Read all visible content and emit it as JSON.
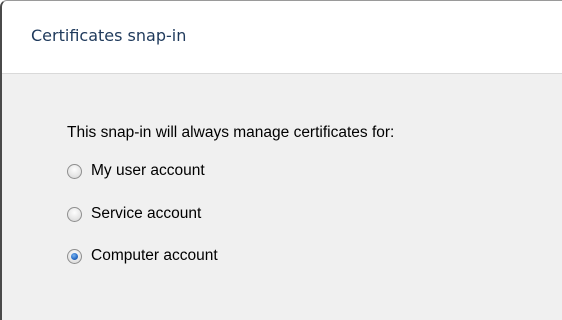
{
  "dialog": {
    "title": "Certificates snap-in"
  },
  "form": {
    "prompt": "This snap-in will always manage certificates for:",
    "options": [
      {
        "label": "My user account",
        "selected": false
      },
      {
        "label": "Service account",
        "selected": false
      },
      {
        "label": "Computer account",
        "selected": true
      }
    ]
  }
}
